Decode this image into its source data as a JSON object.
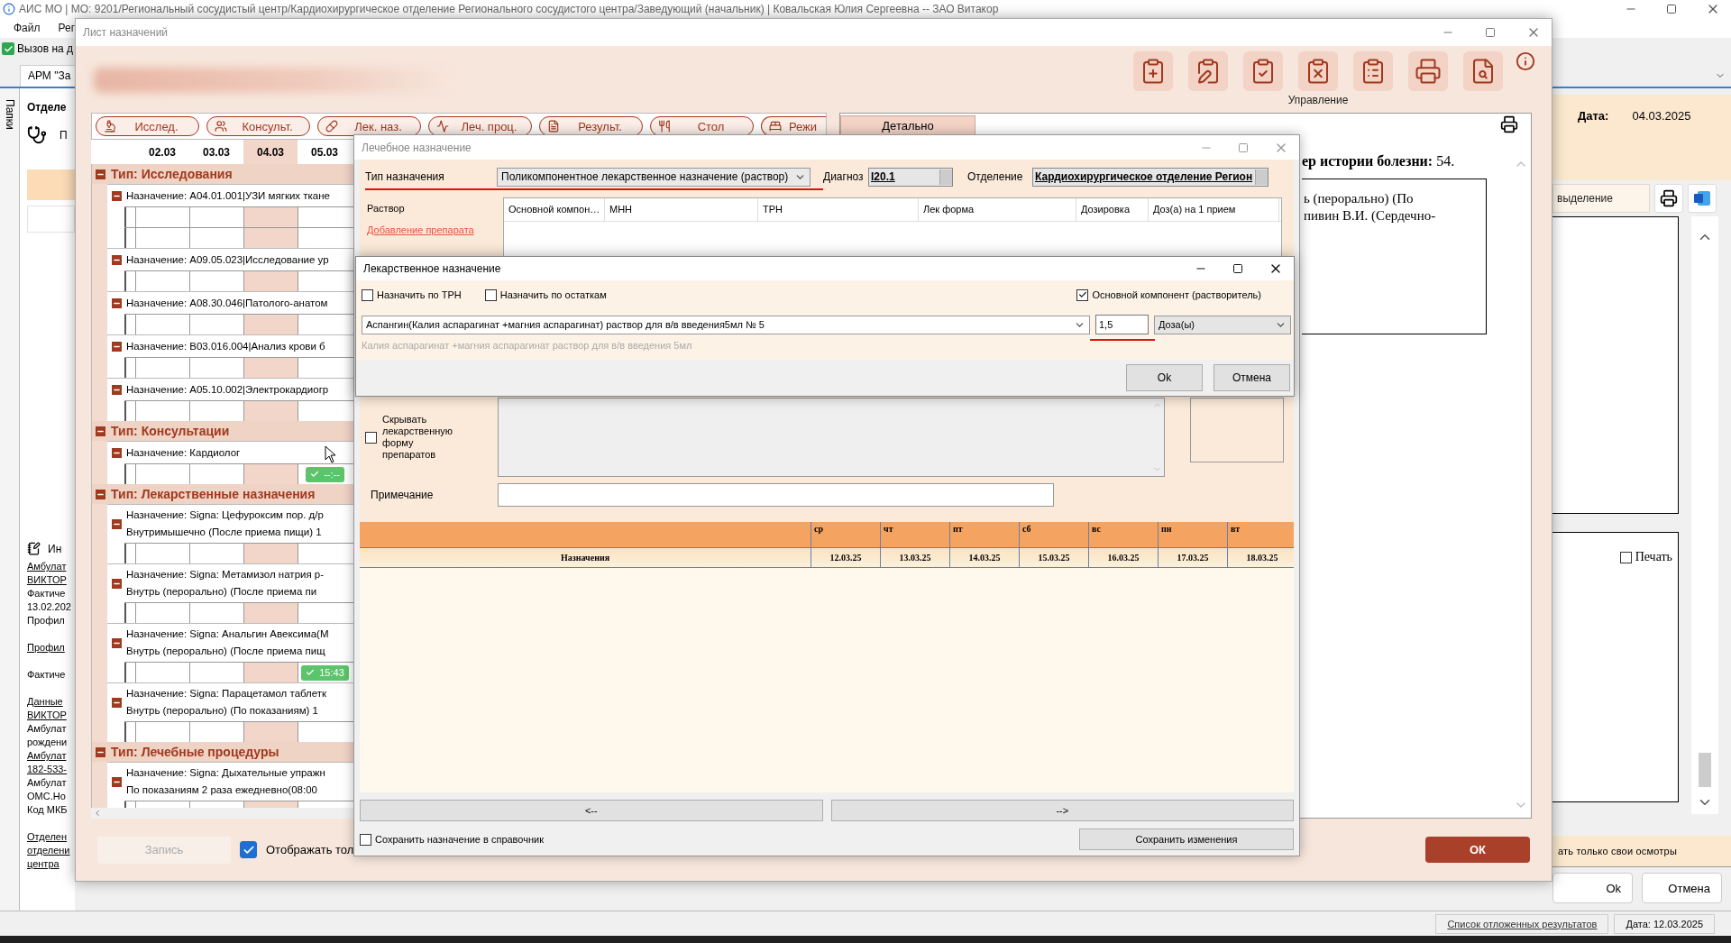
{
  "app": {
    "title": "АИС МО | МО: 9201/Региональный сосудистый центр/Кардиохирургическое отделение Регионального сосудистого центра/Заведующий (начальник) | Ковальская Юлия Сергеевна -- ЗАО Витакор",
    "menu": [
      "Файл",
      "Рег"
    ],
    "toolbar_item": "Вызов на д",
    "tab": "АРМ \"За",
    "side_tab": "Папки",
    "left_panel": {
      "title": "Отделе",
      "button": "П",
      "info_label": "Ин",
      "paragraphs": [
        [
          {
            "text": "Амбулат",
            "link": true
          },
          {
            "text": "ВИКТОР",
            "link": true
          },
          {
            "text": "Фактиче",
            "link": false
          },
          {
            "text": "13.02.202",
            "link": false
          },
          {
            "text": "Профил",
            "link": false
          }
        ],
        [
          {
            "text": "Профил",
            "link": true
          }
        ],
        [
          {
            "text": "Фактиче",
            "link": false
          }
        ],
        [
          {
            "text": "Данные",
            "link": true
          },
          {
            "text": "ВИКТОР",
            "link": true
          },
          {
            "text": "Амбулат",
            "link": false
          },
          {
            "text": "рождени",
            "link": false
          },
          {
            "text": "Амбулат",
            "link": true
          },
          {
            "text": "182-533-",
            "link": true
          },
          {
            "text": "Амбулат",
            "link": false
          },
          {
            "text": "ОМС.Но",
            "link": false
          },
          {
            "text": "Код МКБ",
            "link": false
          }
        ],
        [
          {
            "text": "Отделен",
            "link": true
          },
          {
            "text": "отделени",
            "link": true
          },
          {
            "text": "центра",
            "link": true
          }
        ]
      ]
    },
    "right_panel": {
      "date_label": "Дата:",
      "date": "04.03.2025",
      "selection_button": "выделение",
      "print_checkbox": {
        "label": "Печать",
        "checked": false
      },
      "filter_text": "ать только свои осмотры",
      "buttons": [
        "Ok",
        "Отмена"
      ]
    },
    "status_bar": {
      "link": "Список отложенных результатов",
      "date": "Дата: 12.03.2025"
    }
  },
  "sheet": {
    "title": "Лист назначений",
    "toolbar_label": "Управление",
    "tabs": [
      {
        "label": "Исслед.",
        "kind": "research"
      },
      {
        "label": "Консульт.",
        "kind": "consult"
      },
      {
        "label": "Лек. наз.",
        "kind": "drug"
      },
      {
        "label": "Леч. проц.",
        "kind": "procedure"
      },
      {
        "label": "Результ.",
        "kind": "result"
      },
      {
        "label": "Стол",
        "kind": "diet"
      },
      {
        "label": "Режи",
        "kind": "regime"
      }
    ],
    "detail_tab": "Детально",
    "dates": [
      {
        "label": "02.03",
        "selected": false
      },
      {
        "label": "03.03",
        "selected": false
      },
      {
        "label": "04.03",
        "selected": true
      },
      {
        "label": "05.03",
        "selected": false
      }
    ],
    "groups": [
      {
        "title": "Тип: Исследования",
        "expanded": true,
        "items": [
          {
            "lines": [
              "Назначение: A04.01.001|УЗИ мягких ткане"
            ],
            "rows": [
              [
                {
                  "kind": "blank"
                },
                {
                  "kind": "blank"
                },
                {
                  "kind": "blank"
                },
                {
                  "kind": "blank"
                }
              ],
              [
                {
                  "kind": "blank"
                },
                {
                  "kind": "blank"
                },
                {
                  "kind": "blank"
                },
                {
                  "kind": "blank"
                }
              ]
            ]
          },
          {
            "lines": [
              "Назначение: A09.05.023|Исследование ур"
            ],
            "rows": [
              [
                {
                  "kind": "blank"
                },
                {
                  "kind": "blank"
                },
                {
                  "kind": "blank"
                },
                {
                  "kind": "blank"
                }
              ]
            ]
          },
          {
            "lines": [
              "Назначение: A08.30.046|Патолого-анатом"
            ],
            "rows": [
              [
                {
                  "kind": "blank"
                },
                {
                  "kind": "blank"
                },
                {
                  "kind": "blank"
                },
                {
                  "kind": "blank"
                }
              ]
            ]
          },
          {
            "lines": [
              "Назначение: B03.016.004|Анализ крови б"
            ],
            "rows": [
              [
                {
                  "kind": "blank"
                },
                {
                  "kind": "blank"
                },
                {
                  "kind": "blank"
                },
                {
                  "kind": "blank"
                }
              ]
            ]
          },
          {
            "lines": [
              "Назначение: A05.10.002|Электрокардиогр"
            ],
            "rows": [
              [
                {
                  "kind": "blank"
                },
                {
                  "kind": "blank"
                },
                {
                  "kind": "blank"
                },
                {
                  "kind": "blank"
                }
              ]
            ]
          }
        ]
      },
      {
        "title": "Тип: Консультации",
        "expanded": true,
        "items": [
          {
            "lines": [
              "Назначение: Кардиолог"
            ],
            "rows": [
              [
                {
                  "kind": "blank"
                },
                {
                  "kind": "blank"
                },
                {
                  "kind": "blank"
                },
                {
                  "kind": "done",
                  "time": "--:--"
                }
              ]
            ]
          }
        ]
      },
      {
        "title": "Тип: Лекарственные назначения",
        "expanded": true,
        "items": [
          {
            "lines": [
              "Назначение: Signa: Цефуроксим пор. д/р",
              "Внутримышечно (После приема пищи) 1"
            ],
            "rows": [
              [
                {
                  "kind": "blank"
                },
                {
                  "kind": "blank"
                },
                {
                  "kind": "blank"
                },
                {
                  "kind": "blank"
                }
              ]
            ]
          },
          {
            "lines": [
              "Назначение: Signa: Метамизол натрия р-",
              "Внутрь (перорально) (После приема пи"
            ],
            "rows": [
              [
                {
                  "kind": "blank"
                },
                {
                  "kind": "blank"
                },
                {
                  "kind": "blank"
                },
                {
                  "kind": "blank"
                }
              ]
            ]
          },
          {
            "lines": [
              "Назначение: Signa: Анальгин Авексима(M",
              "Внутрь (перорально) (После приема пищ"
            ],
            "rows": [
              [
                {
                  "kind": "blank"
                },
                {
                  "kind": "blank"
                },
                {
                  "kind": "blank"
                },
                {
                  "kind": "done",
                  "time": "15:43"
                }
              ]
            ]
          },
          {
            "lines": [
              "Назначение: Signa: Парацетамол таблетк",
              "Внутрь (перорально) (По показаниям) 1"
            ],
            "rows": [
              [
                {
                  "kind": "blank"
                },
                {
                  "kind": "blank"
                },
                {
                  "kind": "blank"
                },
                {
                  "kind": "blank"
                }
              ]
            ]
          }
        ]
      },
      {
        "title": "Тип: Лечебные процедуры",
        "expanded": true,
        "items": [
          {
            "lines": [
              "Назначение: Signa: Дыхательные упражн",
              "По показаниям 2 раза ежедневно(08:00"
            ],
            "rows": [
              [
                {
                  "kind": "blank"
                },
                {
                  "kind": "blank"
                },
                {
                  "kind": "blank"
                },
                {
                  "kind": "blank"
                }
              ]
            ]
          }
        ]
      }
    ],
    "record_button": {
      "label": "Запись",
      "disabled": true
    },
    "show_only": {
      "label": "Отображать тол",
      "checked": true
    },
    "ok_button": "ОК",
    "document": {
      "heading": "**ер истории болезни:** 54.",
      "lines": [
        "ь (перорально) (По",
        "пивин В.И. (Сердечно-"
      ]
    }
  },
  "treatment": {
    "title": "Лечебное назначение",
    "type_label": "Тип назначения",
    "type_value": "Поликомпонентное лекарственное назначение (раствор)",
    "diagnosis_label": "Диагноз",
    "diagnosis": "I20.1",
    "department_label": "Отделение",
    "department": "Кардиохирургическое отделение Регион",
    "solution_label": "Раствор",
    "add_link": "Добавление препарата",
    "columns": [
      "Основной компон…",
      "МНН",
      "ТРН",
      "Лек форма",
      "Дозировка",
      "Доз(а) на 1 прием"
    ],
    "hide_form": {
      "label": "Скрывать лекарственную форму препаратов",
      "checked": false
    },
    "note_label": "Примечание",
    "schedule": {
      "first_column": "Назначения",
      "days": [
        {
          "day": "ср",
          "date": "12.03.25"
        },
        {
          "day": "чт",
          "date": "13.03.25"
        },
        {
          "day": "пт",
          "date": "14.03.25"
        },
        {
          "day": "сб",
          "date": "15.03.25"
        },
        {
          "day": "вс",
          "date": "16.03.25"
        },
        {
          "day": "пн",
          "date": "17.03.25"
        },
        {
          "day": "вт",
          "date": "18.03.25"
        }
      ]
    },
    "prev": "<--",
    "next": "-->",
    "save_to_catalog": {
      "label": "Сохранить назначение в справочник",
      "checked": false
    },
    "save_button": "Сохранить изменения"
  },
  "drug_dialog": {
    "title": "Лекарственное назначение",
    "checks": [
      {
        "label": "Назначить по ТРН",
        "checked": false
      },
      {
        "label": "Назначить по остаткам",
        "checked": false
      },
      {
        "label": "Основной компонент (растворитель)",
        "checked": true
      }
    ],
    "drug": "Аспангин(Калия аспарагинат +магния аспарагинат) раствор для в/в введения5мл № 5",
    "dose": "1,5",
    "unit": "Доза(ы)",
    "hint": "Калия аспарагинат +магния аспарагинат раствор для в/в введения 5мл",
    "ok": "Ok",
    "cancel": "Отмена"
  }
}
